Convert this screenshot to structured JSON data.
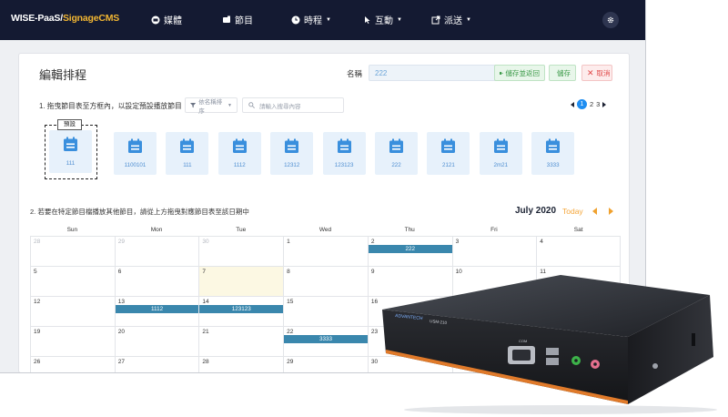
{
  "topnav": {
    "brand_a": "WISE-PaaS/",
    "brand_b": "SignageCMS",
    "items": [
      {
        "label": "媒體",
        "icon": "media-icon"
      },
      {
        "label": "節目",
        "icon": "program-icon"
      },
      {
        "label": "時程",
        "icon": "schedule-icon"
      },
      {
        "label": "互動",
        "icon": "interactive-icon"
      },
      {
        "label": "派送",
        "icon": "deploy-icon"
      }
    ],
    "settings_icon": "gear-icon"
  },
  "editor": {
    "title": "編輯排程",
    "name_label": "名稱",
    "name_value": "222",
    "btn_save_as": "儲存並返回",
    "btn_save": "儲存",
    "btn_cancel": "取消"
  },
  "programs": {
    "step_text": "1. 拖曳節目表至方框內，以設定預設播放節目",
    "sort_label": "依名稱排序",
    "search_placeholder": "請輸入搜尋內容",
    "pager": {
      "current": "1",
      "pages": [
        "2",
        "3"
      ]
    },
    "default_tag": "預設",
    "default_program": "111",
    "items": [
      "1100101",
      "111",
      "1112",
      "12312",
      "123123",
      "222",
      "2121",
      "2m21",
      "3333"
    ]
  },
  "calendar": {
    "step_text": "2. 若要在特定節目檔播放其他節目，請從上方拖曳對應節目表至該日期中",
    "month_title": "July 2020",
    "today_label": "Today",
    "weekdays": [
      "Sun",
      "Mon",
      "Tue",
      "Wed",
      "Thu",
      "Fri",
      "Sat"
    ],
    "weeks": [
      [
        "28",
        "29",
        "30",
        "1",
        "2",
        "3",
        "4"
      ],
      [
        "5",
        "6",
        "7",
        "8",
        "9",
        "10",
        "11"
      ],
      [
        "12",
        "13",
        "14",
        "15",
        "16",
        "17",
        "18"
      ],
      [
        "19",
        "20",
        "21",
        "22",
        "23",
        "24",
        "25"
      ],
      [
        "26",
        "27",
        "28",
        "29",
        "30",
        "31",
        "1"
      ]
    ],
    "events": [
      {
        "label": "222",
        "week": 0,
        "day": 4
      },
      {
        "label": "1112",
        "week": 2,
        "day": 1
      },
      {
        "label": "123123",
        "week": 2,
        "day": 2
      },
      {
        "label": "3333",
        "week": 3,
        "day": 3
      }
    ],
    "today": {
      "week": 1,
      "day": 2
    },
    "event_color": "#3a87ad"
  },
  "device": {
    "brand": "ADVANTECH",
    "model": "USM-210",
    "port_label": "COM"
  },
  "colors": {
    "nav_bg": "#141a32",
    "brand_accent": "#f2b632",
    "today_accent": "#f4a63a",
    "program_tile": "#e7f1fb",
    "program_icon": "#3a8fdd"
  }
}
